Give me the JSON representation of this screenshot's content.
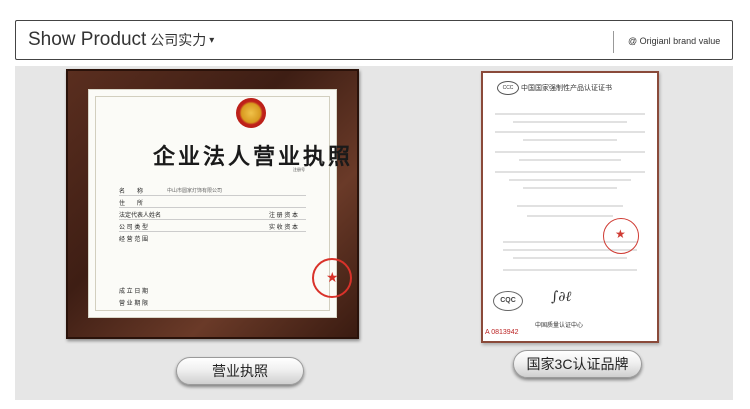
{
  "header": {
    "title": "Show Product",
    "title_cn": "公司实力",
    "dropdown_arrow": "▾",
    "right_icon": "@",
    "right_text": "Origianl brand value"
  },
  "license": {
    "title": "企业法人营业执照",
    "reg_no": "注册号",
    "rows": [
      {
        "label": "名　　称",
        "value": "中山市圆家灯饰有限公司"
      },
      {
        "label": "住　　所",
        "value": ""
      },
      {
        "label": "法定代表人姓名",
        "value": ""
      },
      {
        "label": "公 司 类 型",
        "value": ""
      },
      {
        "label": "经 营 范 围",
        "value": ""
      }
    ],
    "right_rows": [
      {
        "label": "注 册 资 本",
        "value": ""
      },
      {
        "label": "实 收 资 本",
        "value": ""
      }
    ],
    "footer_rows": [
      "成 立 日 期",
      "营 业 期 限"
    ]
  },
  "certificate": {
    "title": "中国国家强制性产品认证证书",
    "ccc_mark": "CCC",
    "cqc_logo": "CQC",
    "center_name": "中国质量认证中心",
    "serial": "A 0813942"
  },
  "buttons": {
    "license_label": "营业执照",
    "cert_label": "国家3C认证品牌"
  },
  "colors": {
    "panel_bg": "#e6e6e6",
    "frame_wood": "#4a2417",
    "stamp_red": "#d9322a"
  }
}
